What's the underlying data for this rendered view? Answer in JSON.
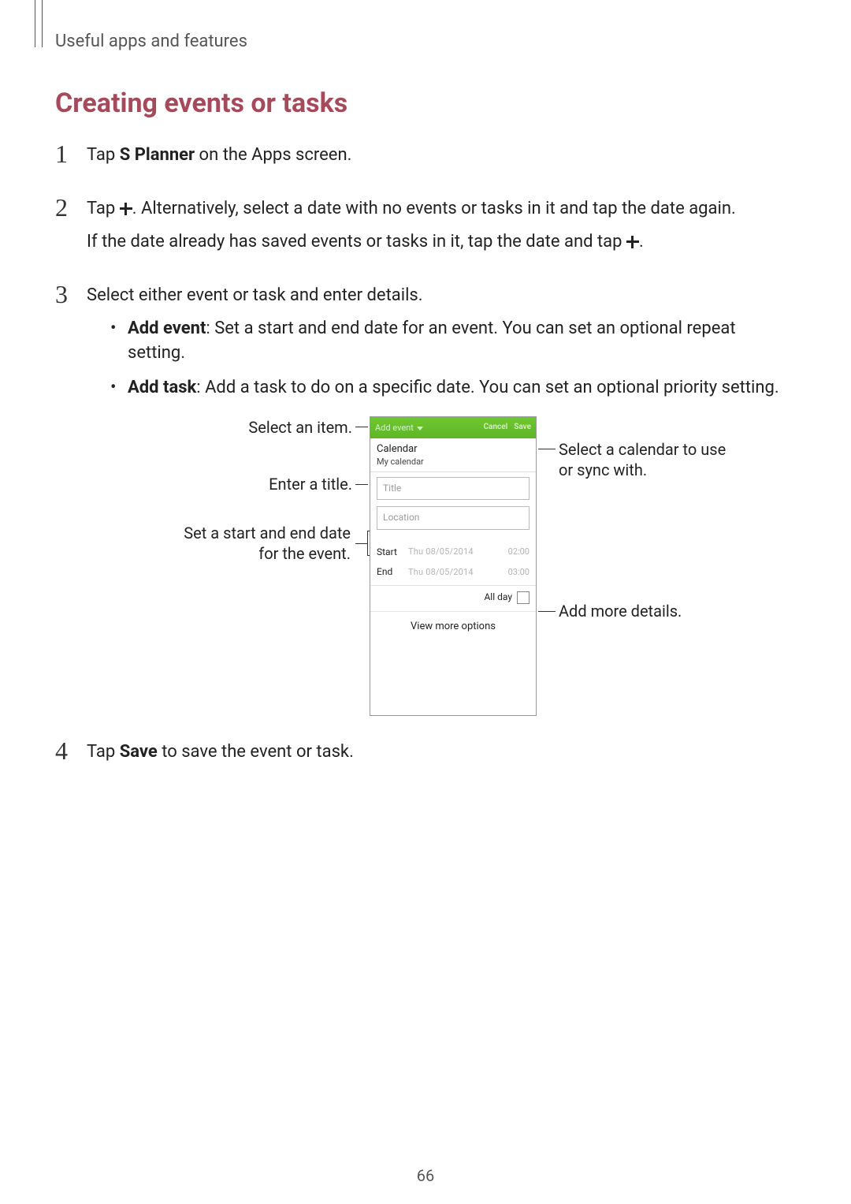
{
  "breadcrumb": "Useful apps and features",
  "section_title": "Creating events or tasks",
  "steps": {
    "s1": {
      "num": "1",
      "pre": "Tap ",
      "bold": "S Planner",
      "post": " on the Apps screen."
    },
    "s2": {
      "num": "2",
      "line1_pre": "Tap ",
      "line1_post": ". Alternatively, select a date with no events or tasks in it and tap the date again.",
      "line2_pre": "If the date already has saved events or tasks in it, tap the date and tap ",
      "line2_post": "."
    },
    "s3": {
      "num": "3",
      "intro": "Select either event or task and enter details.",
      "b1_bold": "Add event",
      "b1_rest": ": Set a start and end date for an event. You can set an optional repeat setting.",
      "b2_bold": "Add task",
      "b2_rest": ": Add a task to do on a specific date. You can set an optional priority setting."
    },
    "s4": {
      "num": "4",
      "pre": "Tap ",
      "bold": "Save",
      "post": " to save the event or task."
    }
  },
  "callouts": {
    "left": {
      "select_item": "Select an item.",
      "enter_title": "Enter a title.",
      "start_end": "Set a start and end date for the event."
    },
    "right": {
      "select_calendar": "Select a calendar to use or sync with.",
      "add_more": "Add more details."
    }
  },
  "phone": {
    "top_tab": "Add event",
    "top_cancel": "Cancel",
    "top_save": "Save",
    "cal_label": "Calendar",
    "cal_sub": "My calendar",
    "title_placeholder": "Title",
    "location_placeholder": "Location",
    "start_lbl": "Start",
    "end_lbl": "End",
    "start_date": "Thu 08/05/2014",
    "start_time": "02:00",
    "end_date": "Thu 08/05/2014",
    "end_time": "03:00",
    "all_day": "All day",
    "view_more": "View more options"
  },
  "page_number": "66"
}
